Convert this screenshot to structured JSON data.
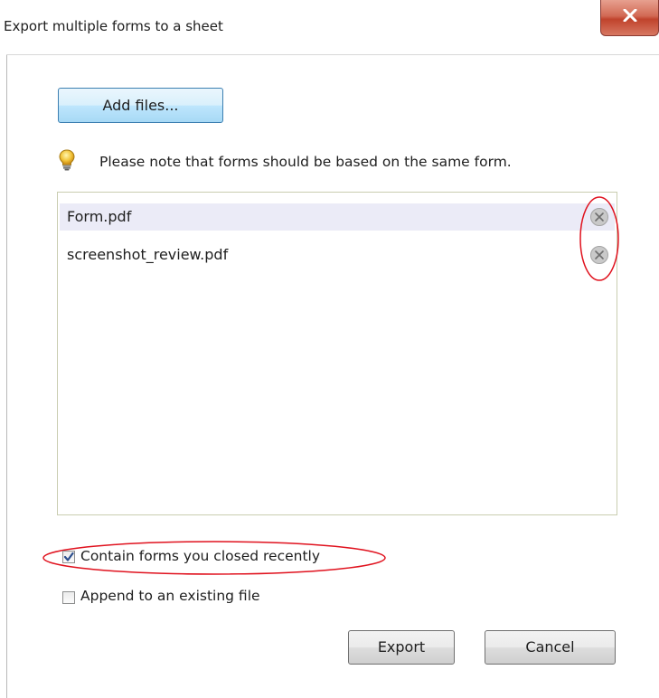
{
  "window": {
    "title": "Export multiple forms to a sheet",
    "close_icon": "close-x-icon",
    "close_color": "#c8452f"
  },
  "toolbar": {
    "add_files_label": "Add files..."
  },
  "note": {
    "icon": "lightbulb-icon",
    "text": "Please note that forms should be based on the same form."
  },
  "file_list": {
    "items": [
      {
        "name": "Form.pdf",
        "selected": true,
        "remove_icon": "remove-circle-x-icon"
      },
      {
        "name": "screenshot_review.pdf",
        "selected": false,
        "remove_icon": "remove-circle-x-icon"
      }
    ]
  },
  "options": {
    "contain_closed": {
      "label": "Contain forms you closed recently",
      "checked": true
    },
    "append_existing": {
      "label": "Append to an existing file",
      "checked": false
    }
  },
  "buttons": {
    "export_label": "Export",
    "cancel_label": "Cancel"
  },
  "annotations": {
    "color": "#e0121e"
  }
}
